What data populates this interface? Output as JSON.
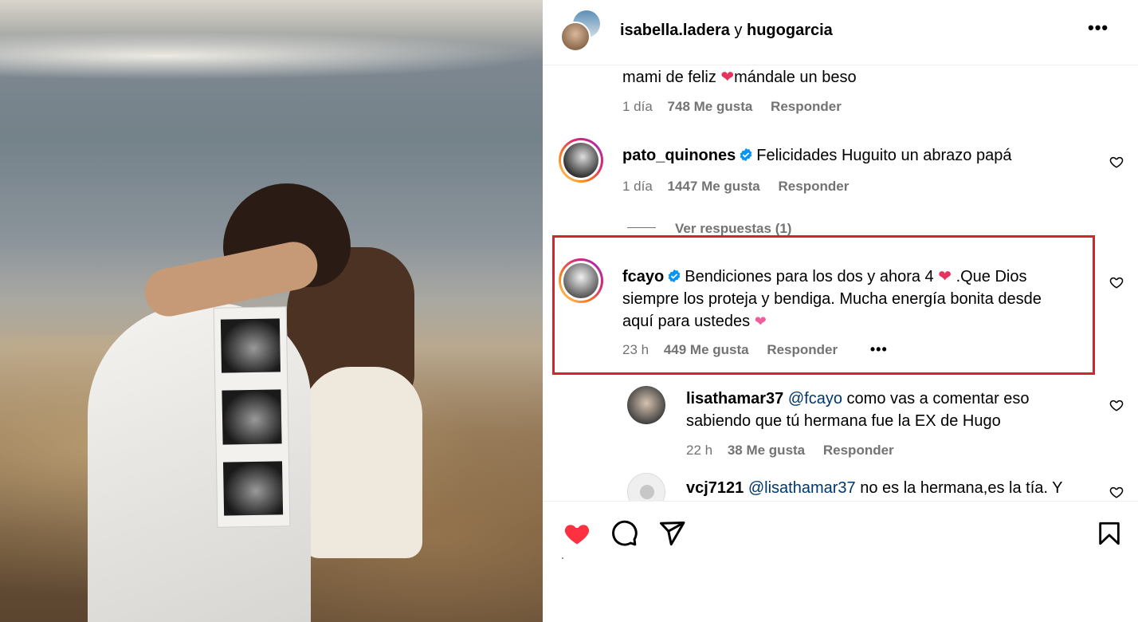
{
  "header": {
    "user1": "isabella.ladera",
    "joiner": " y ",
    "user2": "hugogarcia",
    "more_icon": "more-horizontal-icon"
  },
  "comments": [
    {
      "id": "c0",
      "text": "mami de feliz",
      "text_after": "mándale un beso",
      "time": "1 día",
      "likes": "748 Me gusta",
      "reply": "Responder"
    },
    {
      "id": "c1",
      "user": "pato_quinones",
      "verified": true,
      "text": "Felicidades Huguito un abrazo papá",
      "time": "1 día",
      "likes": "1447 Me gusta",
      "reply": "Responder",
      "view_replies": "Ver respuestas (1)"
    },
    {
      "id": "c2",
      "user": "fcayo",
      "verified": true,
      "text_part1": "Bendiciones para los dos y ahora 4",
      "text_part2": ".Que Dios",
      "text_line2": "siempre los proteja y bendiga. Mucha energía bonita desde",
      "text_line3": "aquí para ustedes",
      "time": "23 h",
      "likes": "449 Me gusta",
      "reply": "Responder",
      "highlighted": true
    },
    {
      "id": "c3",
      "user": "lisathamar37",
      "mention": "@fcayo",
      "text_line1": "como vas a comentar eso",
      "text_line2": "sabiendo que tú hermana fue la EX de Hugo",
      "time": "22 h",
      "likes": "38 Me gusta",
      "reply": "Responder"
    },
    {
      "id": "c4",
      "user": "vcj7121",
      "mention": "@lisathamar37",
      "text": "no es la hermana,es la tía. Y"
    }
  ],
  "actions": {
    "like_icon": "heart-filled-icon",
    "comment_icon": "comment-icon",
    "share_icon": "share-icon",
    "save_icon": "bookmark-icon",
    "like_color": "#ff3040"
  },
  "colors": {
    "highlight_border": "#d1252f",
    "meta_text": "#737373",
    "mention_link": "#00376b",
    "verified_badge": "#0095f6"
  }
}
